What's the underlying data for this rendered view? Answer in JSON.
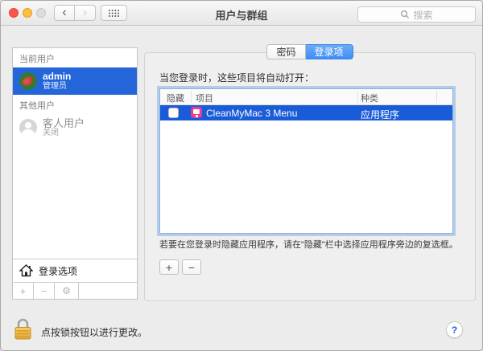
{
  "window": {
    "title": "用户与群组",
    "search_placeholder": "搜索"
  },
  "sidebar": {
    "current_user_header": "当前用户",
    "admin": {
      "name": "admin",
      "role": "管理员",
      "selected": true
    },
    "other_users_header": "其他用户",
    "guest": {
      "name": "客人用户",
      "status": "关闭"
    },
    "login_options_label": "登录选项",
    "toolbar": {
      "add": "+",
      "remove": "−",
      "gear": "⚙"
    }
  },
  "tabs": [
    {
      "label": "密码",
      "active": false
    },
    {
      "label": "登录项",
      "active": true
    }
  ],
  "content": {
    "intro": "当您登录时，这些项目将自动打开：",
    "table": {
      "columns": [
        "隐藏",
        "项目",
        "种类"
      ],
      "rows": [
        {
          "hidden": false,
          "item": "CleanMyMac 3 Menu",
          "kind": "应用程序",
          "selected": true,
          "icon": "cleanmymac-icon"
        }
      ]
    },
    "footnote": "若要在您登录时隐藏应用程序，请在\"隐藏\"栏中选择应用程序旁边的复选框。",
    "add_label": "+",
    "remove_label": "−"
  },
  "footer": {
    "lock_text": "点按锁按钮以进行更改。",
    "help_label": "?"
  },
  "colors": {
    "selection_blue": "#1a5cd7",
    "sidebar_selection_blue": "#2466d9",
    "tab_active_blue": "#3e8ef6",
    "focus_ring_blue": "#8cb4e4",
    "lock_gold": "#f2b93d",
    "app_icon_pink": "#ec3c8d"
  }
}
